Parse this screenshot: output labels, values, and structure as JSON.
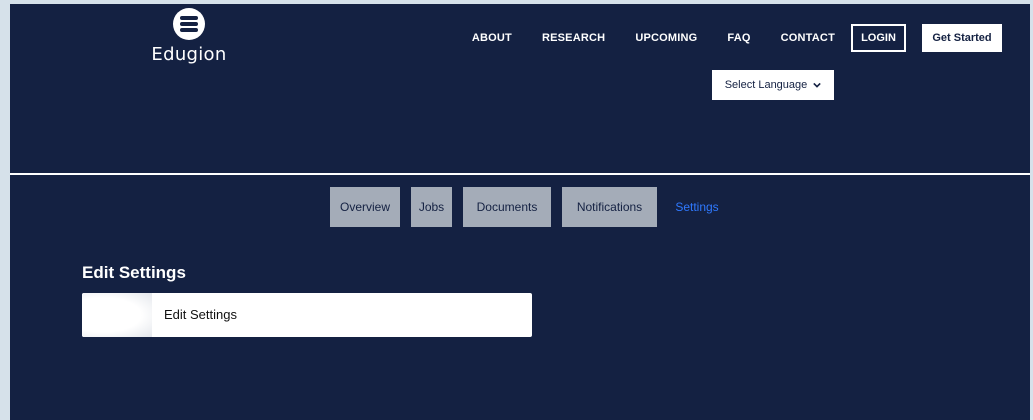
{
  "brand": {
    "name": "Edugion",
    "logo_icon": "book-stack-icon"
  },
  "nav": {
    "links": [
      "ABOUT",
      "RESEARCH",
      "UPCOMING",
      "FAQ",
      "CONTACT"
    ],
    "login_label": "LOGIN",
    "get_started_label": "Get Started"
  },
  "language": {
    "selected": "Select Language",
    "icon": "chevron-down-icon"
  },
  "tabs": [
    "Overview",
    "Jobs",
    "Documents",
    "Notifications",
    "Settings"
  ],
  "active_tab": "Settings",
  "section": {
    "title": "Edit Settings",
    "card_label": "Edit Settings"
  },
  "colors": {
    "background": "#142142",
    "accent": "#2f79ff",
    "tab_bg": "#a4acb8"
  }
}
